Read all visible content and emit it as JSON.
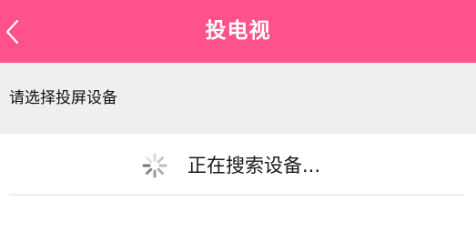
{
  "header": {
    "back_icon": "chevron-left-icon",
    "title": "投电视",
    "background_color": "#ff528d"
  },
  "prompt": {
    "text": "请选择投屏设备"
  },
  "device_list": {
    "status_icon": "loading-spinner-icon",
    "status_text": "正在搜索设备..."
  }
}
